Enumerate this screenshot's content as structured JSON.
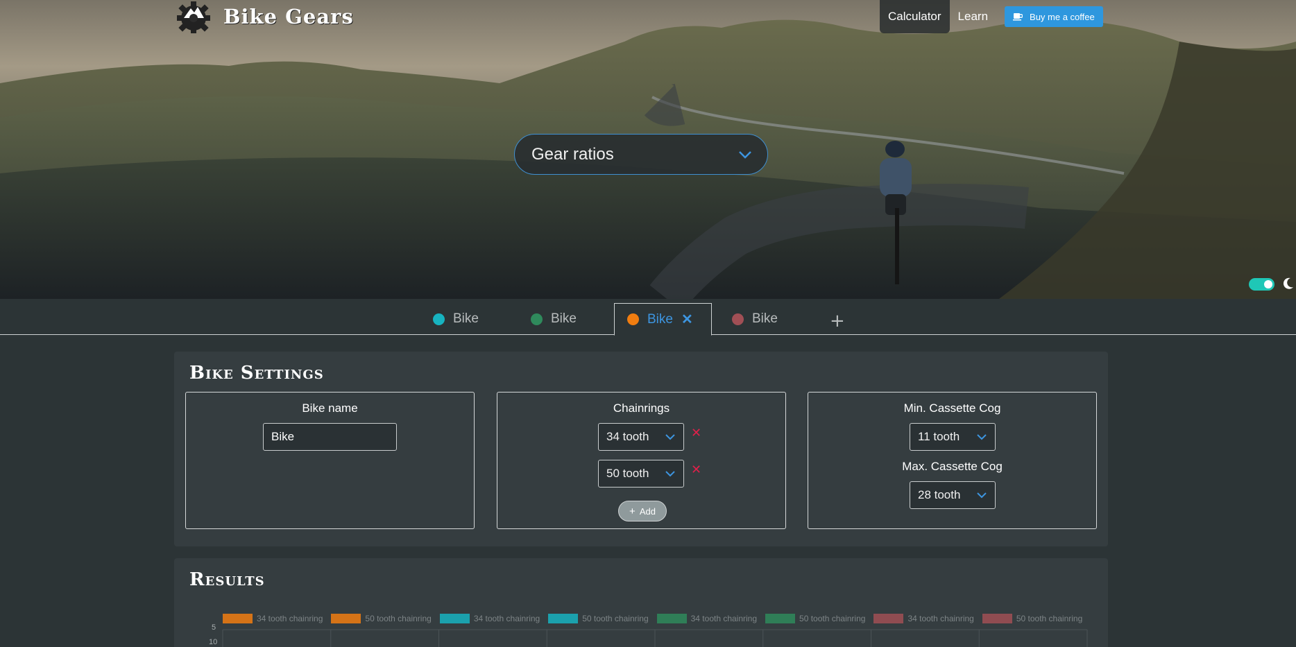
{
  "brand": {
    "title": "Bike Gears"
  },
  "nav": {
    "items": [
      {
        "label": "Calculator",
        "active": true
      },
      {
        "label": "Learn",
        "active": false
      }
    ],
    "coffee_label": "Buy me a coffee"
  },
  "mode_select": {
    "value": "Gear ratios"
  },
  "theme_toggle": {
    "dark_mode": true
  },
  "tabs": [
    {
      "label": "Bike",
      "color": "#17b3c0",
      "active": false
    },
    {
      "label": "Bike",
      "color": "#2f8a5c",
      "active": false
    },
    {
      "label": "Bike",
      "color": "#f17d10",
      "active": true
    },
    {
      "label": "Bike",
      "color": "#a14f55",
      "active": false
    }
  ],
  "settings": {
    "title": "Bike Settings",
    "bike_name": {
      "label": "Bike name",
      "value": "Bike"
    },
    "chainrings": {
      "label": "Chainrings",
      "items": [
        "34 tooth",
        "50 tooth"
      ],
      "add_label": "Add"
    },
    "cassette": {
      "min_label": "Min. Cassette Cog",
      "min_value": "11 tooth",
      "max_label": "Max. Cassette Cog",
      "max_value": "28 tooth"
    }
  },
  "results": {
    "title": "Results",
    "chart_data": {
      "type": "line",
      "legend": [
        {
          "name": "34 tooth chainring",
          "color": "#f17d10"
        },
        {
          "name": "50 tooth chainring",
          "color": "#f17d10"
        },
        {
          "name": "34 tooth chainring",
          "color": "#17b3c0"
        },
        {
          "name": "50 tooth chainring",
          "color": "#17b3c0"
        },
        {
          "name": "34 tooth chainring",
          "color": "#2f8a5c"
        },
        {
          "name": "50 tooth chainring",
          "color": "#2f8a5c"
        },
        {
          "name": "34 tooth chainring",
          "color": "#a14f55"
        },
        {
          "name": "50 tooth chainring",
          "color": "#a14f55"
        }
      ],
      "yticks": [
        "5",
        "10"
      ]
    }
  }
}
